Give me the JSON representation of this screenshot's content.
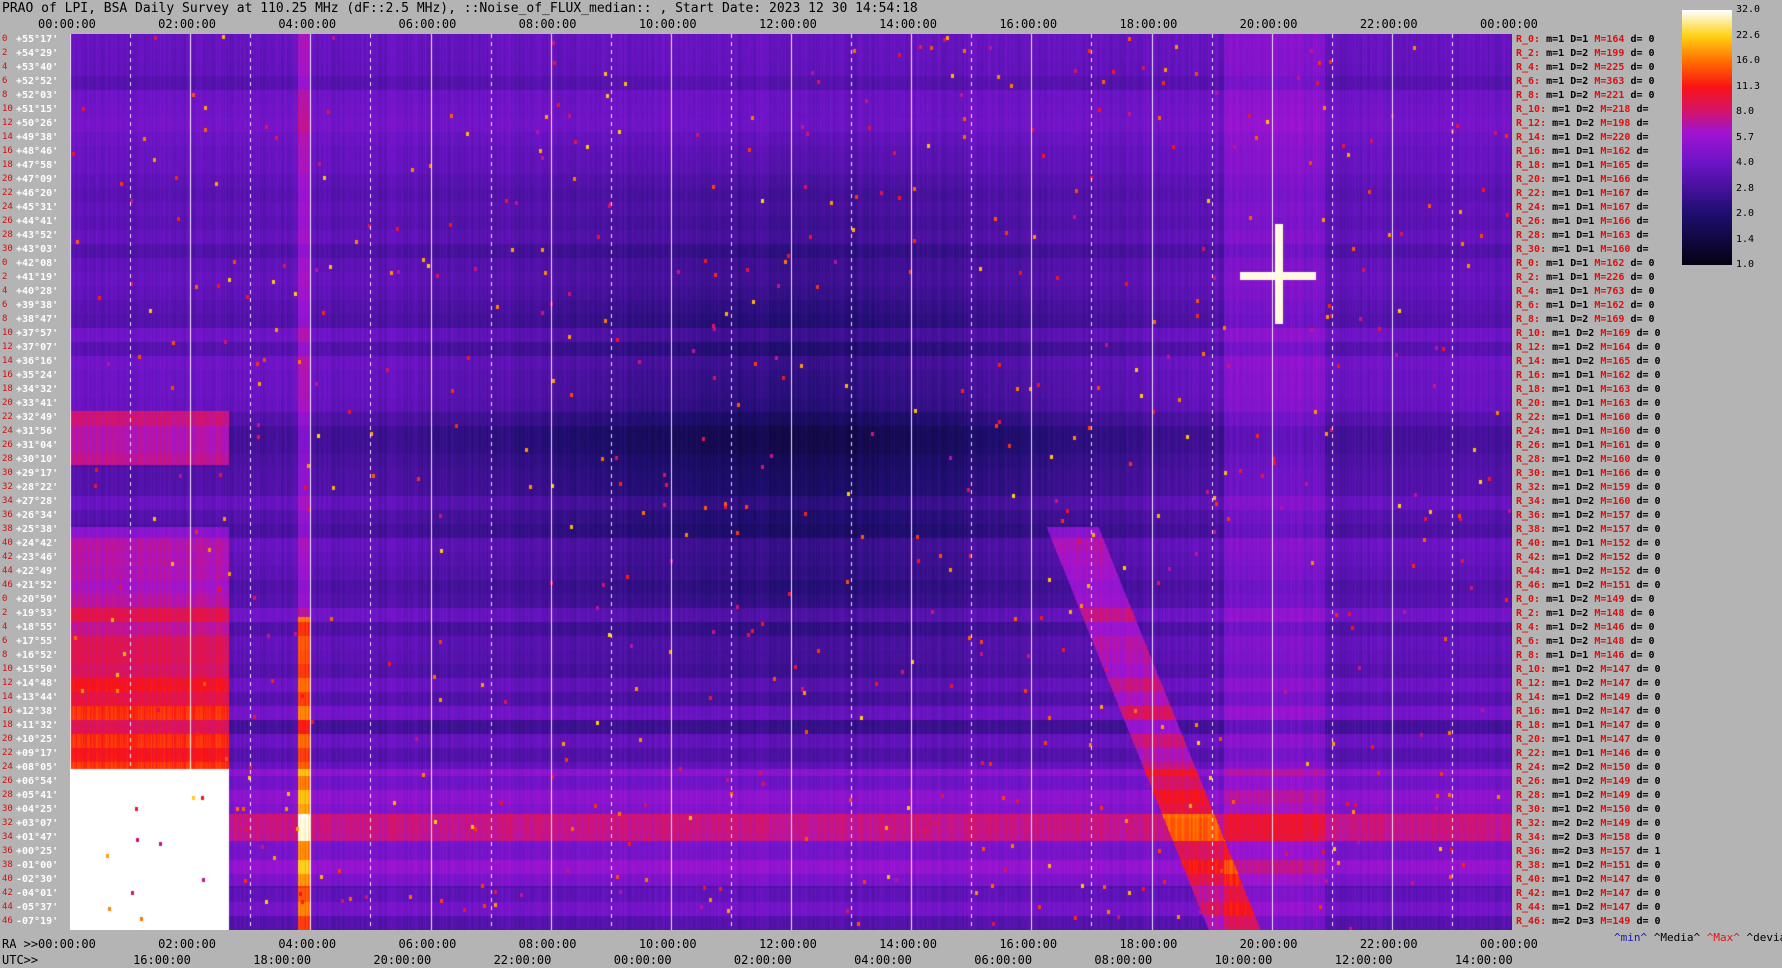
{
  "title": "PRAO of LPI, BSA Daily Survey at 110.25 MHz (dF::2.5 MHz), ::Noise_of_FLUX_median:: , Start Date: 2023 12 30 14:54:18",
  "chart_data": {
    "type": "heatmap",
    "title": "PRAO of LPI, BSA Daily Survey at 110.25 MHz (dF::2.5 MHz), ::Noise_of_FLUX_median:: , Start Date: 2023 12 30 14:54:18",
    "top_axis_ticks": [
      "00:00:00",
      "02:00:00",
      "04:00:00",
      "06:00:00",
      "08:00:00",
      "10:00:00",
      "12:00:00",
      "14:00:00",
      "16:00:00",
      "18:00:00",
      "20:00:00",
      "22:00:00",
      "00:00:00"
    ],
    "ra_axis_label": "RA >>",
    "ra_axis_ticks": [
      "00:00:00",
      "02:00:00",
      "04:00:00",
      "06:00:00",
      "08:00:00",
      "10:00:00",
      "12:00:00",
      "14:00:00",
      "16:00:00",
      "18:00:00",
      "20:00:00",
      "22:00:00",
      "00:00:00"
    ],
    "utc_axis_label": "UTC>>",
    "utc_axis_ticks": [
      "16:00:00",
      "18:00:00",
      "20:00:00",
      "22:00:00",
      "00:00:00",
      "02:00:00",
      "04:00:00",
      "06:00:00",
      "08:00:00",
      "10:00:00",
      "12:00:00",
      "14:00:00"
    ],
    "declinations": [
      "+55°17'",
      "+54°29'",
      "+53°40'",
      "+52°52'",
      "+52°03'",
      "+51°15'",
      "+50°26'",
      "+49°38'",
      "+48°46'",
      "+47°58'",
      "+47°09'",
      "+46°20'",
      "+45°31'",
      "+44°41'",
      "+43°52'",
      "+43°03'",
      "+42°08'",
      "+41°19'",
      "+40°28'",
      "+39°38'",
      "+38°47'",
      "+37°57'",
      "+37°07'",
      "+36°16'",
      "+35°24'",
      "+34°32'",
      "+33°41'",
      "+32°49'",
      "+31°56'",
      "+31°04'",
      "+30°10'",
      "+29°17'",
      "+28°22'",
      "+27°28'",
      "+26°34'",
      "+25°38'",
      "+24°42'",
      "+23°46'",
      "+22°49'",
      "+21°52'",
      "+20°50'",
      "+19°53'",
      "+18°55'",
      "+17°55'",
      "+16°52'",
      "+15°50'",
      "+14°48'",
      "+13°44'",
      "+12°38'",
      "+11°32'",
      "+10°25'",
      "+09°17'",
      "+08°05'",
      "+06°54'",
      "+05°41'",
      "+04°25'",
      "+03°07'",
      "+01°47'",
      "+00°25'",
      "-01°00'",
      "-02°30'",
      "-04°01'",
      "-05°37'",
      "-07°19'"
    ],
    "row_indices": [
      "0",
      "2",
      "4",
      "6",
      "8",
      "10",
      "12",
      "14",
      "16",
      "18",
      "20",
      "22",
      "24",
      "26",
      "28",
      "30",
      "0",
      "2",
      "4",
      "6",
      "8",
      "10",
      "12",
      "14",
      "16",
      "18",
      "20",
      "22",
      "24",
      "26",
      "28",
      "30",
      "32",
      "34",
      "36",
      "38",
      "40",
      "42",
      "44",
      "46",
      "0",
      "2",
      "4",
      "6",
      "8",
      "10",
      "12",
      "14",
      "16",
      "18",
      "20",
      "22",
      "24",
      "26",
      "28",
      "30",
      "32",
      "34",
      "36",
      "38",
      "40",
      "42",
      "44",
      "46"
    ],
    "colorbar": {
      "ticks": [
        "32.0",
        "22.6",
        "16.0",
        "11.3",
        "8.0",
        "5.7",
        "4.0",
        "2.8",
        "2.0",
        "1.4",
        "1.0"
      ],
      "scale": "log2",
      "min": 1.0,
      "max": 32.0
    },
    "stats_rows": [
      {
        "r": "R_0:",
        "m": "m=1",
        "D": "D=1",
        "M": "M=164",
        "d": "d= 0"
      },
      {
        "r": "R_2:",
        "m": "m=1",
        "D": "D=2",
        "M": "M=199",
        "d": "d= 0"
      },
      {
        "r": "R_4:",
        "m": "m=1",
        "D": "D=2",
        "M": "M=225",
        "d": "d= 0"
      },
      {
        "r": "R_6:",
        "m": "m=1",
        "D": "D=2",
        "M": "M=363",
        "d": "d= 0"
      },
      {
        "r": "R_8:",
        "m": "m=1",
        "D": "D=2",
        "M": "M=221",
        "d": "d= 0"
      },
      {
        "r": "R_10:",
        "m": "m=1",
        "D": "D=2",
        "M": "M=218",
        "d": "d="
      },
      {
        "r": "R_12:",
        "m": "m=1",
        "D": "D=2",
        "M": "M=198",
        "d": "d="
      },
      {
        "r": "R_14:",
        "m": "m=1",
        "D": "D=2",
        "M": "M=220",
        "d": "d="
      },
      {
        "r": "R_16:",
        "m": "m=1",
        "D": "D=1",
        "M": "M=162",
        "d": "d="
      },
      {
        "r": "R_18:",
        "m": "m=1",
        "D": "D=1",
        "M": "M=165",
        "d": "d="
      },
      {
        "r": "R_20:",
        "m": "m=1",
        "D": "D=1",
        "M": "M=166",
        "d": "d="
      },
      {
        "r": "R_22:",
        "m": "m=1",
        "D": "D=1",
        "M": "M=167",
        "d": "d="
      },
      {
        "r": "R_24:",
        "m": "m=1",
        "D": "D=1",
        "M": "M=167",
        "d": "d="
      },
      {
        "r": "R_26:",
        "m": "m=1",
        "D": "D=1",
        "M": "M=166",
        "d": "d="
      },
      {
        "r": "R_28:",
        "m": "m=1",
        "D": "D=1",
        "M": "M=163",
        "d": "d="
      },
      {
        "r": "R_30:",
        "m": "m=1",
        "D": "D=1",
        "M": "M=160",
        "d": "d="
      },
      {
        "r": "R_0:",
        "m": "m=1",
        "D": "D=1",
        "M": "M=162",
        "d": "d= 0"
      },
      {
        "r": "R_2:",
        "m": "m=1",
        "D": "D=1",
        "M": "M=226",
        "d": "d= 0"
      },
      {
        "r": "R_4:",
        "m": "m=1",
        "D": "D=1",
        "M": "M=763",
        "d": "d= 0"
      },
      {
        "r": "R_6:",
        "m": "m=1",
        "D": "D=1",
        "M": "M=162",
        "d": "d= 0"
      },
      {
        "r": "R_8:",
        "m": "m=1",
        "D": "D=2",
        "M": "M=169",
        "d": "d= 0"
      },
      {
        "r": "R_10:",
        "m": "m=1",
        "D": "D=2",
        "M": "M=169",
        "d": "d= 0"
      },
      {
        "r": "R_12:",
        "m": "m=1",
        "D": "D=2",
        "M": "M=164",
        "d": "d= 0"
      },
      {
        "r": "R_14:",
        "m": "m=1",
        "D": "D=2",
        "M": "M=165",
        "d": "d= 0"
      },
      {
        "r": "R_16:",
        "m": "m=1",
        "D": "D=1",
        "M": "M=162",
        "d": "d= 0"
      },
      {
        "r": "R_18:",
        "m": "m=1",
        "D": "D=1",
        "M": "M=163",
        "d": "d= 0"
      },
      {
        "r": "R_20:",
        "m": "m=1",
        "D": "D=1",
        "M": "M=163",
        "d": "d= 0"
      },
      {
        "r": "R_22:",
        "m": "m=1",
        "D": "D=1",
        "M": "M=160",
        "d": "d= 0"
      },
      {
        "r": "R_24:",
        "m": "m=1",
        "D": "D=1",
        "M": "M=160",
        "d": "d= 0"
      },
      {
        "r": "R_26:",
        "m": "m=1",
        "D": "D=1",
        "M": "M=161",
        "d": "d= 0"
      },
      {
        "r": "R_28:",
        "m": "m=1",
        "D": "D=2",
        "M": "M=160",
        "d": "d= 0"
      },
      {
        "r": "R_30:",
        "m": "m=1",
        "D": "D=1",
        "M": "M=166",
        "d": "d= 0"
      },
      {
        "r": "R_32:",
        "m": "m=1",
        "D": "D=2",
        "M": "M=159",
        "d": "d= 0"
      },
      {
        "r": "R_34:",
        "m": "m=1",
        "D": "D=2",
        "M": "M=160",
        "d": "d= 0"
      },
      {
        "r": "R_36:",
        "m": "m=1",
        "D": "D=2",
        "M": "M=157",
        "d": "d= 0"
      },
      {
        "r": "R_38:",
        "m": "m=1",
        "D": "D=2",
        "M": "M=157",
        "d": "d= 0"
      },
      {
        "r": "R_40:",
        "m": "m=1",
        "D": "D=1",
        "M": "M=152",
        "d": "d= 0"
      },
      {
        "r": "R_42:",
        "m": "m=1",
        "D": "D=2",
        "M": "M=152",
        "d": "d= 0"
      },
      {
        "r": "R_44:",
        "m": "m=1",
        "D": "D=2",
        "M": "M=152",
        "d": "d= 0"
      },
      {
        "r": "R_46:",
        "m": "m=1",
        "D": "D=2",
        "M": "M=151",
        "d": "d= 0"
      },
      {
        "r": "R_0:",
        "m": "m=1",
        "D": "D=2",
        "M": "M=149",
        "d": "d= 0"
      },
      {
        "r": "R_2:",
        "m": "m=1",
        "D": "D=2",
        "M": "M=148",
        "d": "d= 0"
      },
      {
        "r": "R_4:",
        "m": "m=1",
        "D": "D=2",
        "M": "M=146",
        "d": "d= 0"
      },
      {
        "r": "R_6:",
        "m": "m=1",
        "D": "D=2",
        "M": "M=148",
        "d": "d= 0"
      },
      {
        "r": "R_8:",
        "m": "m=1",
        "D": "D=1",
        "M": "M=146",
        "d": "d= 0"
      },
      {
        "r": "R_10:",
        "m": "m=1",
        "D": "D=2",
        "M": "M=147",
        "d": "d= 0"
      },
      {
        "r": "R_12:",
        "m": "m=1",
        "D": "D=2",
        "M": "M=147",
        "d": "d= 0"
      },
      {
        "r": "R_14:",
        "m": "m=1",
        "D": "D=2",
        "M": "M=149",
        "d": "d= 0"
      },
      {
        "r": "R_16:",
        "m": "m=1",
        "D": "D=2",
        "M": "M=147",
        "d": "d= 0"
      },
      {
        "r": "R_18:",
        "m": "m=1",
        "D": "D=1",
        "M": "M=147",
        "d": "d= 0"
      },
      {
        "r": "R_20:",
        "m": "m=1",
        "D": "D=1",
        "M": "M=147",
        "d": "d= 0"
      },
      {
        "r": "R_22:",
        "m": "m=1",
        "D": "D=1",
        "M": "M=146",
        "d": "d= 0"
      },
      {
        "r": "R_24:",
        "m": "m=2",
        "D": "D=2",
        "M": "M=150",
        "d": "d= 0"
      },
      {
        "r": "R_26:",
        "m": "m=1",
        "D": "D=2",
        "M": "M=149",
        "d": "d= 0"
      },
      {
        "r": "R_28:",
        "m": "m=1",
        "D": "D=2",
        "M": "M=149",
        "d": "d= 0"
      },
      {
        "r": "R_30:",
        "m": "m=1",
        "D": "D=2",
        "M": "M=150",
        "d": "d= 0"
      },
      {
        "r": "R_32:",
        "m": "m=2",
        "D": "D=2",
        "M": "M=149",
        "d": "d= 0"
      },
      {
        "r": "R_34:",
        "m": "m=2",
        "D": "D=3",
        "M": "M=158",
        "d": "d= 0"
      },
      {
        "r": "R_36:",
        "m": "m=2",
        "D": "D=3",
        "M": "M=157",
        "d": "d= 1"
      },
      {
        "r": "R_38:",
        "m": "m=1",
        "D": "D=2",
        "M": "M=151",
        "d": "d= 0"
      },
      {
        "r": "R_40:",
        "m": "m=1",
        "D": "D=2",
        "M": "M=147",
        "d": "d= 0"
      },
      {
        "r": "R_42:",
        "m": "m=1",
        "D": "D=2",
        "M": "M=147",
        "d": "d= 0"
      },
      {
        "r": "R_44:",
        "m": "m=1",
        "D": "D=2",
        "M": "M=147",
        "d": "d= 0"
      },
      {
        "r": "R_46:",
        "m": "m=2",
        "D": "D=3",
        "M": "M=149",
        "d": "d= 0"
      }
    ],
    "legend": {
      "min": "^min^",
      "median": "^Media^",
      "max": "^Max^",
      "devia": "^devia^"
    }
  }
}
